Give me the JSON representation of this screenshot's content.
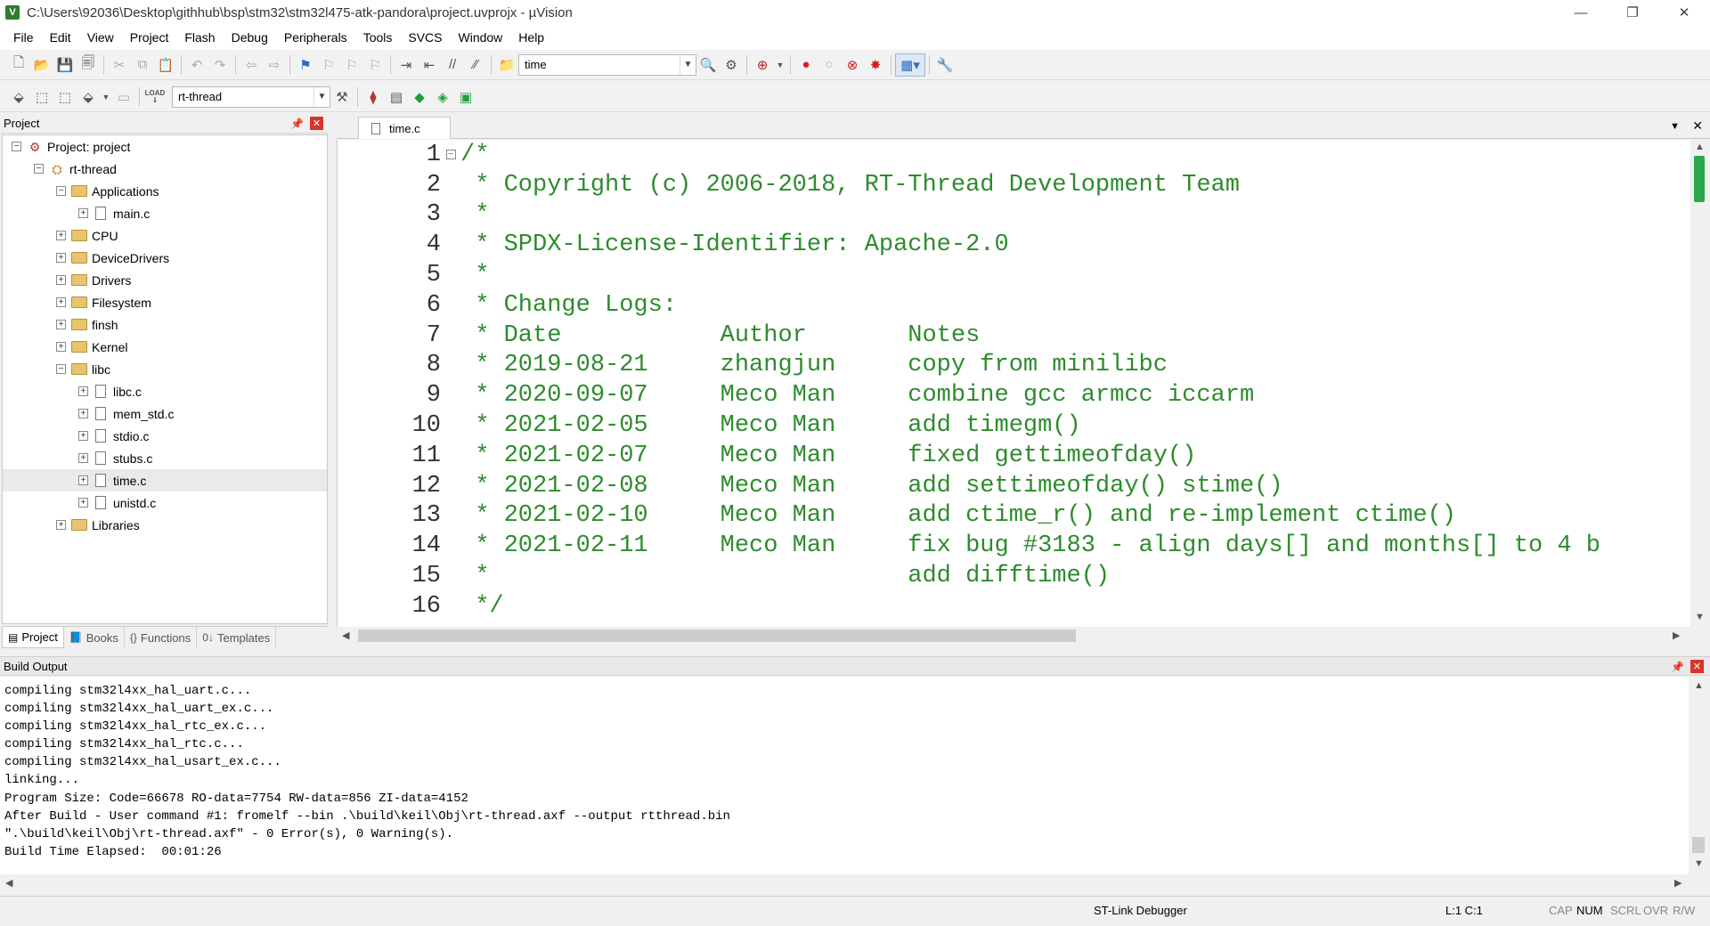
{
  "window": {
    "title": "C:\\Users\\92036\\Desktop\\githhub\\bsp\\stm32\\stm32l475-atk-pandora\\project.uvprojx - µVision",
    "app_glyph": "V",
    "controls": {
      "minimize": "—",
      "restore": "❐",
      "close": "✕"
    }
  },
  "menu": [
    "File",
    "Edit",
    "View",
    "Project",
    "Flash",
    "Debug",
    "Peripherals",
    "Tools",
    "SVCS",
    "Window",
    "Help"
  ],
  "toolbar": {
    "find_value": "time",
    "target_value": "rt-thread",
    "load_label": "LOAD"
  },
  "project_panel": {
    "title": "Project",
    "tree": [
      {
        "label": "Project: project",
        "depth": 0,
        "expander": "−",
        "icon": "project"
      },
      {
        "label": "rt-thread",
        "depth": 1,
        "expander": "−",
        "icon": "target"
      },
      {
        "label": "Applications",
        "depth": 2,
        "expander": "−",
        "icon": "folder"
      },
      {
        "label": "main.c",
        "depth": 3,
        "expander": "+",
        "icon": "file"
      },
      {
        "label": "CPU",
        "depth": 2,
        "expander": "+",
        "icon": "folder"
      },
      {
        "label": "DeviceDrivers",
        "depth": 2,
        "expander": "+",
        "icon": "folder"
      },
      {
        "label": "Drivers",
        "depth": 2,
        "expander": "+",
        "icon": "folder"
      },
      {
        "label": "Filesystem",
        "depth": 2,
        "expander": "+",
        "icon": "folder"
      },
      {
        "label": "finsh",
        "depth": 2,
        "expander": "+",
        "icon": "folder"
      },
      {
        "label": "Kernel",
        "depth": 2,
        "expander": "+",
        "icon": "folder"
      },
      {
        "label": "libc",
        "depth": 2,
        "expander": "−",
        "icon": "folder"
      },
      {
        "label": "libc.c",
        "depth": 3,
        "expander": "+",
        "icon": "file"
      },
      {
        "label": "mem_std.c",
        "depth": 3,
        "expander": "+",
        "icon": "file"
      },
      {
        "label": "stdio.c",
        "depth": 3,
        "expander": "+",
        "icon": "file"
      },
      {
        "label": "stubs.c",
        "depth": 3,
        "expander": "+",
        "icon": "file"
      },
      {
        "label": "time.c",
        "depth": 3,
        "expander": "+",
        "icon": "file",
        "selected": true
      },
      {
        "label": "unistd.c",
        "depth": 3,
        "expander": "+",
        "icon": "file"
      },
      {
        "label": "Libraries",
        "depth": 2,
        "expander": "+",
        "icon": "folder"
      }
    ],
    "tabs": [
      {
        "label": "Project",
        "glyph": "▤",
        "active": true
      },
      {
        "label": "Books",
        "glyph": "📘",
        "active": false
      },
      {
        "label": "Functions",
        "glyph": "{}",
        "active": false
      },
      {
        "label": "Templates",
        "glyph": "0↓",
        "active": false
      }
    ]
  },
  "editor": {
    "tab_label": "time.c",
    "lines": [
      {
        "n": "1",
        "text": "/*"
      },
      {
        "n": "2",
        "text": " * Copyright (c) 2006-2018, RT-Thread Development Team"
      },
      {
        "n": "3",
        "text": " *"
      },
      {
        "n": "4",
        "text": " * SPDX-License-Identifier: Apache-2.0"
      },
      {
        "n": "5",
        "text": " *"
      },
      {
        "n": "6",
        "text": " * Change Logs:"
      },
      {
        "n": "7",
        "text": " * Date           Author       Notes"
      },
      {
        "n": "8",
        "text": " * 2019-08-21     zhangjun     copy from minilibc"
      },
      {
        "n": "9",
        "text": " * 2020-09-07     Meco Man     combine gcc armcc iccarm"
      },
      {
        "n": "10",
        "text": " * 2021-02-05     Meco Man     add timegm()"
      },
      {
        "n": "11",
        "text": " * 2021-02-07     Meco Man     fixed gettimeofday()"
      },
      {
        "n": "12",
        "text": " * 2021-02-08     Meco Man     add settimeofday() stime()"
      },
      {
        "n": "13",
        "text": " * 2021-02-10     Meco Man     add ctime_r() and re-implement ctime()"
      },
      {
        "n": "14",
        "text": " * 2021-02-11     Meco Man     fix bug #3183 - align days[] and months[] to 4 b"
      },
      {
        "n": "15",
        "text": " *                             add difftime()"
      },
      {
        "n": "16",
        "text": " */"
      }
    ]
  },
  "build_output": {
    "title": "Build Output",
    "lines": [
      "compiling stm32l4xx_hal_uart.c...",
      "compiling stm32l4xx_hal_uart_ex.c...",
      "compiling stm32l4xx_hal_rtc_ex.c...",
      "compiling stm32l4xx_hal_rtc.c...",
      "compiling stm32l4xx_hal_usart_ex.c...",
      "linking...",
      "Program Size: Code=66678 RO-data=7754 RW-data=856 ZI-data=4152",
      "After Build - User command #1: fromelf --bin .\\build\\keil\\Obj\\rt-thread.axf --output rtthread.bin",
      "\".\\build\\keil\\Obj\\rt-thread.axf\" - 0 Error(s), 0 Warning(s).",
      "Build Time Elapsed:  00:01:26"
    ]
  },
  "status": {
    "debugger": "ST-Link Debugger",
    "cursor": "L:1 C:1",
    "flags": [
      {
        "label": "CAP",
        "on": false
      },
      {
        "label": "NUM",
        "on": true
      },
      {
        "label": "SCRL",
        "on": false
      },
      {
        "label": "OVR",
        "on": false
      },
      {
        "label": "R/W",
        "on": false
      }
    ]
  },
  "colors": {
    "comment": "#2e8b2e",
    "close_button": "#d9342c",
    "folder": "#e8c46a"
  }
}
